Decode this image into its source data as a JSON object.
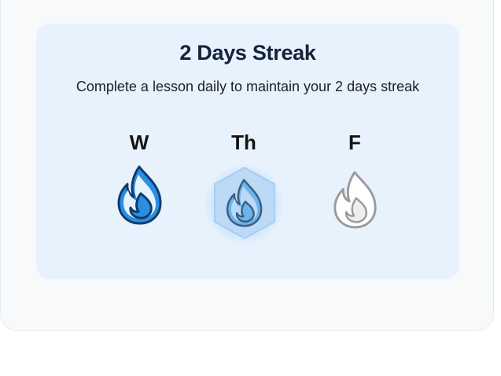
{
  "streak": {
    "title": "2 Days Streak",
    "subtitle": "Complete a lesson daily to maintain your 2 days streak"
  },
  "days": [
    {
      "label": "W",
      "state": "completed",
      "icon": "flame-icon"
    },
    {
      "label": "Th",
      "state": "current",
      "icon": "flame-icon"
    },
    {
      "label": "F",
      "state": "upcoming",
      "icon": "flame-icon"
    }
  ],
  "colors": {
    "card_background": "#e7f2fd",
    "flame_completed": "#2a8ee2",
    "flame_outline_dark": "#0e3c6e",
    "flame_current": "#6eb4ea",
    "hex_fill": "#bcd9f6",
    "flame_upcoming": "#9a9a9a"
  }
}
